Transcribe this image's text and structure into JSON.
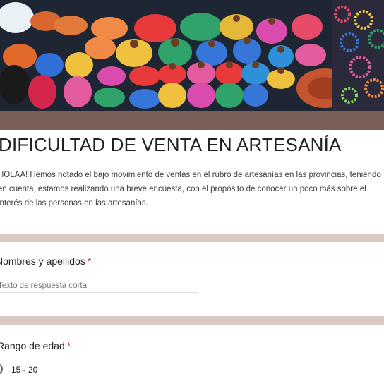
{
  "form": {
    "title": "DIFICULTAD DE VENTA EN ARTESANÍA",
    "description": "HOLAA! Hemos notado el bajo movimiento de ventas en el rubro de artesanías en las provincias, teniendo en cuenta, estamos realizando una breve encuesta, con el propósito de conocer un poco más sobre el interés de las personas en las artesanías.",
    "accent_color": "#7a5e58"
  },
  "questions": [
    {
      "label": "Nombres y apellidos",
      "required_mark": "*",
      "placeholder": "Texto de respuesta corta"
    },
    {
      "label": "Rango de edad",
      "required_mark": "*",
      "options": [
        "15 - 20"
      ]
    }
  ]
}
